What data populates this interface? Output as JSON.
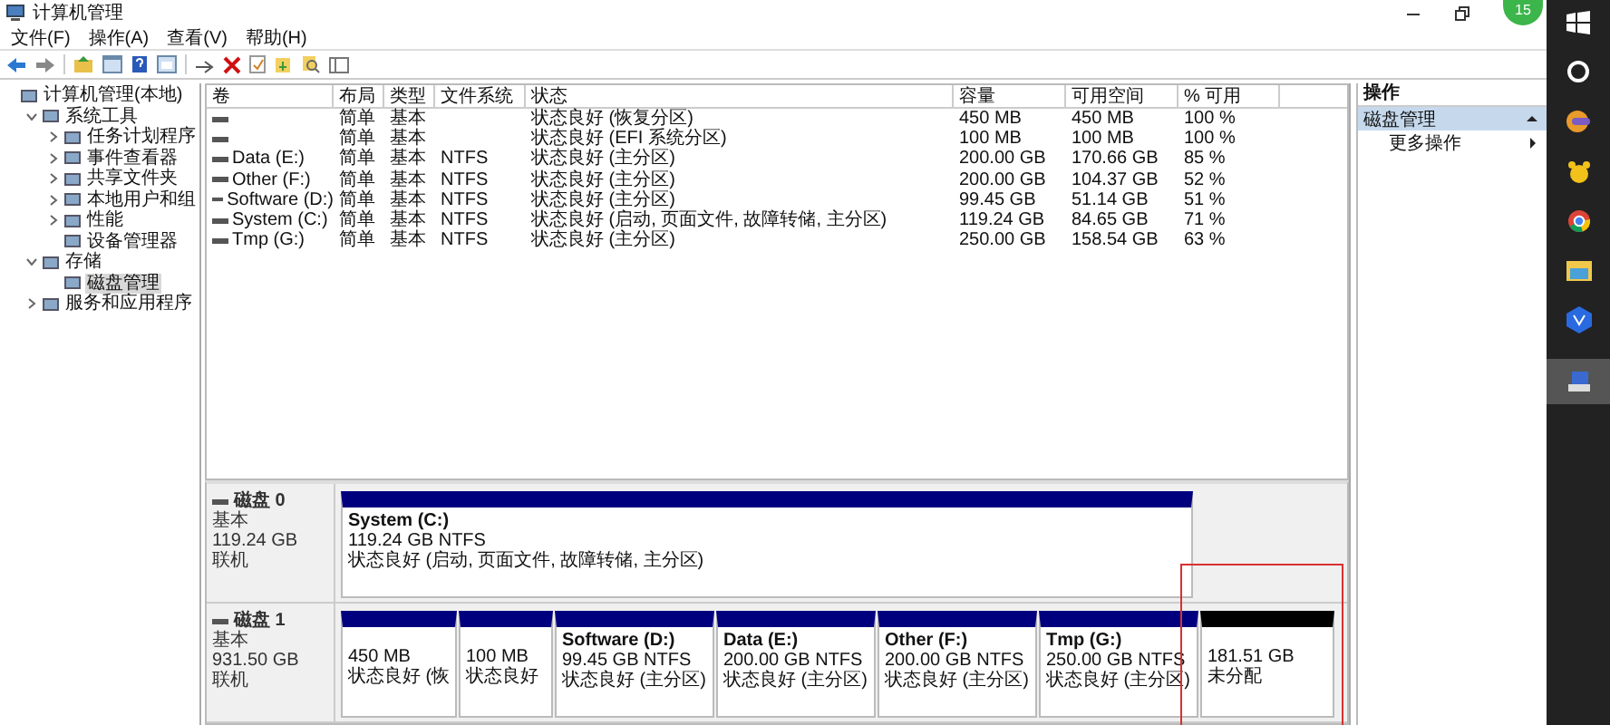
{
  "window": {
    "title": "计算机管理"
  },
  "badge": "15",
  "menu": [
    "文件(F)",
    "操作(A)",
    "查看(V)",
    "帮助(H)"
  ],
  "tree": [
    {
      "label": "计算机管理(本地)",
      "selected": false,
      "children": [
        {
          "label": "系统工具",
          "selected": false,
          "expanded": true,
          "children": [
            {
              "label": "任务计划程序",
              "selected": false,
              "expanded": false
            },
            {
              "label": "事件查看器",
              "selected": false,
              "expanded": false
            },
            {
              "label": "共享文件夹",
              "selected": false,
              "expanded": false
            },
            {
              "label": "本地用户和组",
              "selected": false,
              "expanded": false
            },
            {
              "label": "性能",
              "selected": false,
              "expanded": false
            },
            {
              "label": "设备管理器",
              "selected": false
            }
          ]
        },
        {
          "label": "存储",
          "selected": false,
          "expanded": true,
          "children": [
            {
              "label": "磁盘管理",
              "selected": true
            }
          ]
        },
        {
          "label": "服务和应用程序",
          "selected": false,
          "expanded": false
        }
      ]
    }
  ],
  "table": {
    "columns": [
      "卷",
      "布局",
      "类型",
      "文件系统",
      "状态",
      "容量",
      "可用空间",
      "% 可用"
    ],
    "rows": [
      {
        "layout": "简单",
        "type": "基本",
        "status": "状态良好 (恢复分区)",
        "capacity": "450 MB",
        "free": "450 MB",
        "percent": "100 %"
      },
      {
        "layout": "简单",
        "type": "基本",
        "status": "状态良好 (EFI 系统分区)",
        "capacity": "100 MB",
        "free": "100 MB",
        "percent": "100 %"
      },
      {
        "volume": "Data (E:)",
        "layout": "简单",
        "type": "基本",
        "fs": "NTFS",
        "status": "状态良好 (主分区)",
        "capacity": "200.00 GB",
        "free": "170.66 GB",
        "percent": "85 %"
      },
      {
        "volume": "Other (F:)",
        "layout": "简单",
        "type": "基本",
        "fs": "NTFS",
        "status": "状态良好 (主分区)",
        "capacity": "200.00 GB",
        "free": "104.37 GB",
        "percent": "52 %"
      },
      {
        "volume": "Software (D:)",
        "layout": "简单",
        "type": "基本",
        "fs": "NTFS",
        "status": "状态良好 (主分区)",
        "capacity": "99.45 GB",
        "free": "51.14 GB",
        "percent": "51 %"
      },
      {
        "volume": "System (C:)",
        "layout": "简单",
        "type": "基本",
        "fs": "NTFS",
        "status": "状态良好 (启动, 页面文件, 故障转储, 主分区)",
        "capacity": "119.24 GB",
        "free": "84.65 GB",
        "percent": "71 %"
      },
      {
        "volume": "Tmp (G:)",
        "layout": "简单",
        "type": "基本",
        "fs": "NTFS",
        "status": "状态良好 (主分区)",
        "capacity": "250.00 GB",
        "free": "158.54 GB",
        "percent": "63 %"
      }
    ]
  },
  "disks": [
    {
      "name": "磁盘 0",
      "type": "基本",
      "size": "119.24 GB",
      "state": "联机",
      "partitions": [
        {
          "kind": "primary",
          "title": "System  (C:)",
          "size": "119.24 GB NTFS",
          "status": "状态良好 (启动, 页面文件, 故障转储, 主分区)"
        }
      ]
    },
    {
      "name": "磁盘 1",
      "type": "基本",
      "size": "931.50 GB",
      "state": "联机",
      "partitions": [
        {
          "kind": "primary",
          "size": "450 MB",
          "status": "状态良好 (恢"
        },
        {
          "kind": "primary",
          "size": "100 MB",
          "status": "状态良好"
        },
        {
          "kind": "primary",
          "title": "Software  (D:)",
          "size": "99.45 GB NTFS",
          "status": "状态良好 (主分区)"
        },
        {
          "kind": "primary",
          "title": "Data  (E:)",
          "size": "200.00 GB NTFS",
          "status": "状态良好 (主分区)"
        },
        {
          "kind": "primary",
          "title": "Other  (F:)",
          "size": "200.00 GB NTFS",
          "status": "状态良好 (主分区)"
        },
        {
          "kind": "primary",
          "title": "Tmp  (G:)",
          "size": "250.00 GB NTFS",
          "status": "状态良好 (主分区)"
        },
        {
          "kind": "unallocated",
          "size": "181.51 GB",
          "status": "未分配"
        }
      ]
    }
  ],
  "actions": {
    "header": "操作",
    "section": {
      "label": "磁盘管理",
      "expanded": true
    },
    "items": [
      {
        "label": "更多操作"
      }
    ]
  }
}
